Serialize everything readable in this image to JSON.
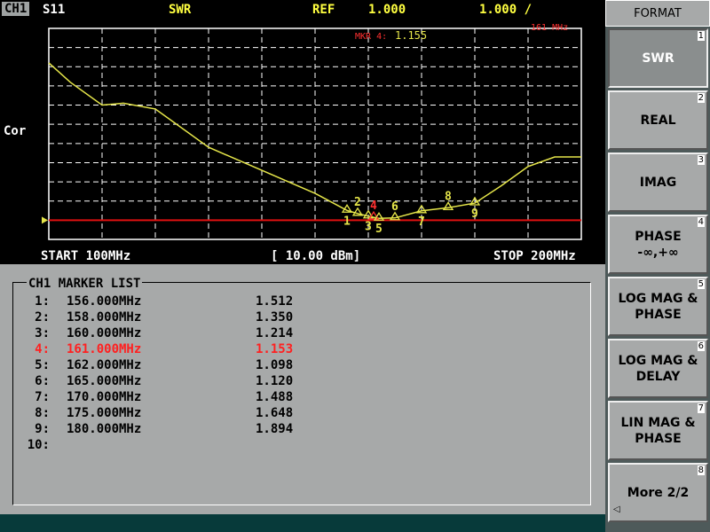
{
  "status": {
    "channel": "CH1",
    "parameter": "S11",
    "format": "SWR",
    "ref_label": "REF",
    "ref_value": "1.000",
    "scale": "1.000 /"
  },
  "plot": {
    "y_label": "Cor",
    "active_marker_label": "MKR 4:",
    "active_marker_value": "1.155",
    "active_marker_freq": "161 MHz",
    "trace_color": "#e6e64a",
    "grid_color": "#ffffff",
    "ref_line_color": "#e01010"
  },
  "freq": {
    "start": "START 100MHz",
    "power": "[ 10.00 dBm]",
    "stop": "STOP 200MHz"
  },
  "chart_data": {
    "type": "line",
    "x": [
      100,
      104,
      110,
      114,
      120,
      130,
      140,
      150,
      156,
      158,
      160,
      161,
      162,
      165,
      170,
      175,
      180,
      185,
      190,
      195,
      200
    ],
    "y": [
      9.2,
      8.2,
      7.0,
      7.1,
      6.8,
      4.8,
      3.6,
      2.4,
      1.51,
      1.35,
      1.21,
      1.15,
      1.1,
      1.12,
      1.49,
      1.65,
      1.89,
      2.8,
      3.8,
      4.3,
      4.3
    ],
    "xlim": [
      100,
      200
    ],
    "ylim": [
      0,
      11
    ],
    "reference": 1.0,
    "markers": [
      {
        "id": "1",
        "x": 156,
        "y": 1.512
      },
      {
        "id": "2",
        "x": 158,
        "y": 1.35
      },
      {
        "id": "3",
        "x": 160,
        "y": 1.214
      },
      {
        "id": "4",
        "x": 161,
        "y": 1.153
      },
      {
        "id": "5",
        "x": 162,
        "y": 1.098
      },
      {
        "id": "6",
        "x": 165,
        "y": 1.12
      },
      {
        "id": "7",
        "x": 170,
        "y": 1.488
      },
      {
        "id": "8",
        "x": 175,
        "y": 1.648
      },
      {
        "id": "9",
        "x": 180,
        "y": 1.894
      }
    ]
  },
  "marker_list": {
    "title": "CH1 MARKER LIST",
    "rows": [
      {
        "num": "1:",
        "freq": "156.000MHz",
        "value": "1.512"
      },
      {
        "num": "2:",
        "freq": "158.000MHz",
        "value": "1.350"
      },
      {
        "num": "3:",
        "freq": "160.000MHz",
        "value": "1.214"
      },
      {
        "num": "4:",
        "freq": "161.000MHz",
        "value": "1.153",
        "active": true
      },
      {
        "num": "5:",
        "freq": "162.000MHz",
        "value": "1.098"
      },
      {
        "num": "6:",
        "freq": "165.000MHz",
        "value": "1.120"
      },
      {
        "num": "7:",
        "freq": "170.000MHz",
        "value": "1.488"
      },
      {
        "num": "8:",
        "freq": "175.000MHz",
        "value": "1.648"
      },
      {
        "num": "9:",
        "freq": "180.000MHz",
        "value": "1.894"
      },
      {
        "num": "10:",
        "freq": "",
        "value": ""
      }
    ]
  },
  "softkeys": {
    "title": "FORMAT",
    "keys": [
      {
        "n": "1",
        "line1": "SWR",
        "line2": "",
        "selected": true
      },
      {
        "n": "2",
        "line1": "REAL",
        "line2": ""
      },
      {
        "n": "3",
        "line1": "IMAG",
        "line2": ""
      },
      {
        "n": "4",
        "line1": "PHASE",
        "line2": "-∞,+∞"
      },
      {
        "n": "5",
        "line1": "LOG MAG &",
        "line2": "PHASE"
      },
      {
        "n": "6",
        "line1": "LOG MAG &",
        "line2": "DELAY"
      },
      {
        "n": "7",
        "line1": "LIN MAG &",
        "line2": "PHASE"
      },
      {
        "n": "8",
        "line1": "More 2/2",
        "line2": "",
        "arrow": "◁"
      }
    ]
  }
}
